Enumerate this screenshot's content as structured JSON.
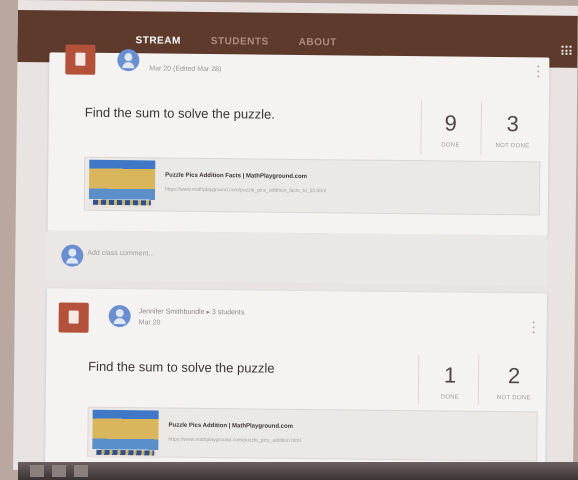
{
  "nav": {
    "tabs": [
      "STREAM",
      "STUDENTS",
      "ABOUT"
    ],
    "active_tab": "STREAM"
  },
  "posts": [
    {
      "date": "Mar 20 (Edited Mar 28)",
      "title": "Find the sum to solve the puzzle.",
      "done_count": "9",
      "done_label": "DONE",
      "not_done_count": "3",
      "not_done_label": "NOT DONE",
      "attachment_title": "Puzzle Pics Addition Facts | MathPlayground.com",
      "attachment_url": "https://www.mathplayground.com/puzzle_pics_addition_facts_to_20.html",
      "comment_placeholder": "Add class comment..."
    },
    {
      "author": "Jennifer Smithbundle",
      "audience": "3 students",
      "date": "Mar 20",
      "title": "Find the sum to solve the puzzle",
      "done_count": "1",
      "done_label": "DONE",
      "not_done_count": "2",
      "not_done_label": "NOT DONE",
      "attachment_title": "Puzzle Pics Addition | MathPlayground.com",
      "attachment_url": "https://www.mathplayground.com/puzzle_pics_addition.html"
    }
  ],
  "colors": {
    "header": "#5e3a2c",
    "assignment_icon": "#b3513a",
    "avatar": "#6a8fd1"
  }
}
